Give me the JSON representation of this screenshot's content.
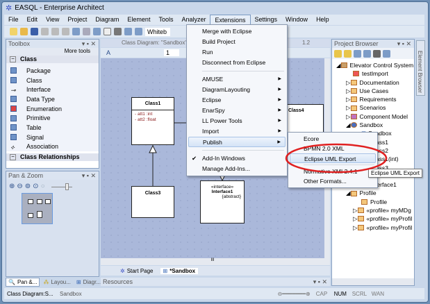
{
  "window": {
    "title": "EASQL - Enterprise Architect"
  },
  "menubar": [
    "File",
    "Edit",
    "View",
    "Project",
    "Diagram",
    "Element",
    "Tools",
    "Analyzer",
    "Extensions",
    "Settings",
    "Window",
    "Help"
  ],
  "toolbar": {
    "combo_value": "Whiteb"
  },
  "toolbox": {
    "title": "Toolbox",
    "more_tools": "More tools",
    "section": "Class",
    "items": [
      "Package",
      "Class",
      "Interface",
      "Data Type",
      "Enumeration",
      "Primitive",
      "Table",
      "Signal",
      "Association"
    ],
    "section2": "Class Relationships"
  },
  "pan_zoom": {
    "title": "Pan & Zoom"
  },
  "left_tabs": [
    "Pan &...",
    "Layou...",
    "Diagr..."
  ],
  "diagram": {
    "title": "Class Diagram: \"Sandbox\"",
    "version": "1.2",
    "font_size": "1",
    "classes": {
      "class1": "Class1",
      "class1_attrs": [
        "att1  :int",
        "att2  :float"
      ],
      "class3": "Class3",
      "class4": "Class4",
      "interface_stereo": "«interface»",
      "interface_name": "Interface1",
      "interface_note": "{abstract}"
    },
    "tabs": [
      "Start Page",
      "*Sandbox"
    ],
    "scroll_label": "III"
  },
  "resources": {
    "title": "Resources"
  },
  "project_browser": {
    "title": "Project Browser",
    "items": [
      "Elevator Control System",
      "testImport",
      "Documentation",
      "Use Cases",
      "Requirements",
      "Scenarios",
      "Component Model",
      "Sandbox",
      "Sandbox",
      "Class1",
      "Class2",
      "Class1(int)",
      "Class3",
      "Interface1",
      "Profile",
      "Profile",
      "«profile» myMDg",
      "«profile» myProfil",
      "«profile» myProfil"
    ]
  },
  "element_browser": "Element Browser",
  "extensions_menu": {
    "items": [
      "Merge with Eclipse",
      "Build Project",
      "Run",
      "Disconnect from Eclipse",
      "AMUSE",
      "DiagramLayouting",
      "Eclipse",
      "EnarSpy",
      "LL Power Tools",
      "Import",
      "Publish",
      "Add-In Windows",
      "Manage Add-Ins..."
    ]
  },
  "publish_submenu": {
    "items": [
      "Ecore",
      "BPMN 2.0 XML",
      "Eclipse UML Export",
      "Normative XMI 2.4.1",
      "Other Formats..."
    ]
  },
  "tooltip": "Eclipse UML Export",
  "status": {
    "left": "Class Diagram:S...",
    "middle": "Sandbox",
    "indicators": [
      "CAP",
      "NUM",
      "SCRL",
      "WAN"
    ]
  },
  "colors": {
    "highlight_ellipse": "#e02020",
    "canvas": "#aab8da"
  }
}
